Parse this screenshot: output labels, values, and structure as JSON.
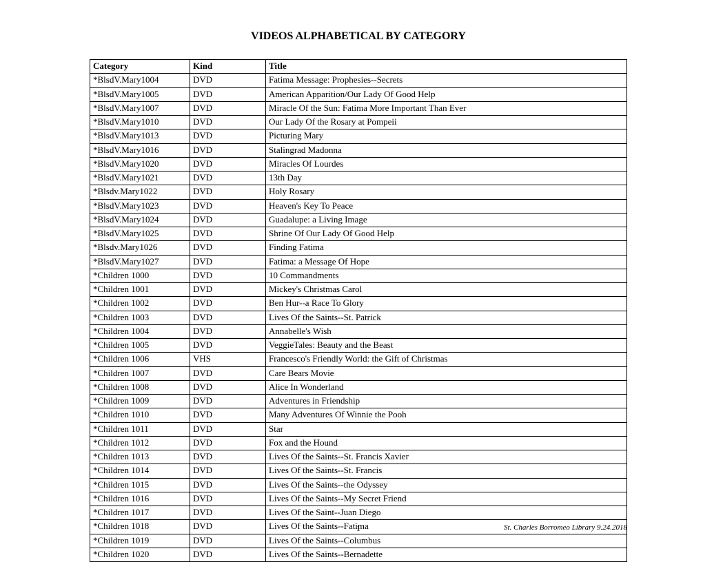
{
  "title": "VIDEOS ALPHABETICAL BY CATEGORY",
  "columns": [
    "Category",
    "Kind",
    "Title"
  ],
  "rows": [
    [
      "*BlsdV.Mary1004",
      "DVD",
      "Fatima Message: Prophesies--Secrets"
    ],
    [
      "*BlsdV.Mary1005",
      "DVD",
      "American Apparition/Our Lady Of Good Help"
    ],
    [
      "*BlsdV.Mary1007",
      "DVD",
      "Miracle Of the Sun: Fatima More Important Than Ever"
    ],
    [
      "*BlsdV.Mary1010",
      "DVD",
      "Our Lady Of the Rosary at Pompeii"
    ],
    [
      "*BlsdV.Mary1013",
      "DVD",
      "Picturing Mary"
    ],
    [
      "*BlsdV.Mary1016",
      "DVD",
      "Stalingrad Madonna"
    ],
    [
      "*BlsdV.Mary1020",
      "DVD",
      "Miracles Of Lourdes"
    ],
    [
      "*BlsdV.Mary1021",
      "DVD",
      "13th Day"
    ],
    [
      "*Blsdv.Mary1022",
      "DVD",
      "Holy Rosary"
    ],
    [
      "*BlsdV.Mary1023",
      "DVD",
      "Heaven's Key To Peace"
    ],
    [
      "*BlsdV.Mary1024",
      "DVD",
      "Guadalupe: a Living Image"
    ],
    [
      "*BlsdV.Mary1025",
      "DVD",
      "Shrine Of Our Lady Of Good Help"
    ],
    [
      "*Blsdv.Mary1026",
      "DVD",
      "Finding Fatima"
    ],
    [
      "*BlsdV.Mary1027",
      "DVD",
      "Fatima: a Message Of Hope"
    ],
    [
      "*Children 1000",
      "DVD",
      "10 Commandments"
    ],
    [
      "*Children 1001",
      "DVD",
      "Mickey's Christmas Carol"
    ],
    [
      "*Children 1002",
      "DVD",
      "Ben Hur--a Race To Glory"
    ],
    [
      "*Children 1003",
      "DVD",
      "Lives Of the Saints--St. Patrick"
    ],
    [
      "*Children 1004",
      "DVD",
      "Annabelle's Wish"
    ],
    [
      "*Children 1005",
      "DVD",
      "VeggieTales: Beauty and the Beast"
    ],
    [
      "*Children 1006",
      "VHS",
      "Francesco's Friendly World: the Gift of Christmas"
    ],
    [
      "*Children 1007",
      "DVD",
      "Care Bears Movie"
    ],
    [
      "*Children 1008",
      "DVD",
      "Alice In Wonderland"
    ],
    [
      "*Children 1009",
      "DVD",
      "Adventures in Friendship"
    ],
    [
      "*Children 1010",
      "DVD",
      "Many Adventures Of Winnie the Pooh"
    ],
    [
      "*Children 1011",
      "DVD",
      "Star"
    ],
    [
      "*Children 1012",
      "DVD",
      "Fox and the Hound"
    ],
    [
      "*Children 1013",
      "DVD",
      "Lives Of the Saints--St. Francis Xavier"
    ],
    [
      "*Children 1014",
      "DVD",
      "Lives Of the Saints--St. Francis"
    ],
    [
      "*Children 1015",
      "DVD",
      "Lives Of the Saints--the Odyssey"
    ],
    [
      "*Children 1016",
      "DVD",
      "Lives Of the Saints--My Secret Friend"
    ],
    [
      "*Children 1017",
      "DVD",
      "Lives Of the Saint--Juan Diego"
    ],
    [
      "*Children 1018",
      "DVD",
      "Lives Of the Saints--Fatima"
    ],
    [
      "*Children 1019",
      "DVD",
      "Lives Of the Saints--Columbus"
    ],
    [
      "*Children 1020",
      "DVD",
      "Lives Of the Saints--Bernadette"
    ]
  ],
  "page_number": "1",
  "footnote": "St. Charles Borromeo Library 9.24.2018"
}
